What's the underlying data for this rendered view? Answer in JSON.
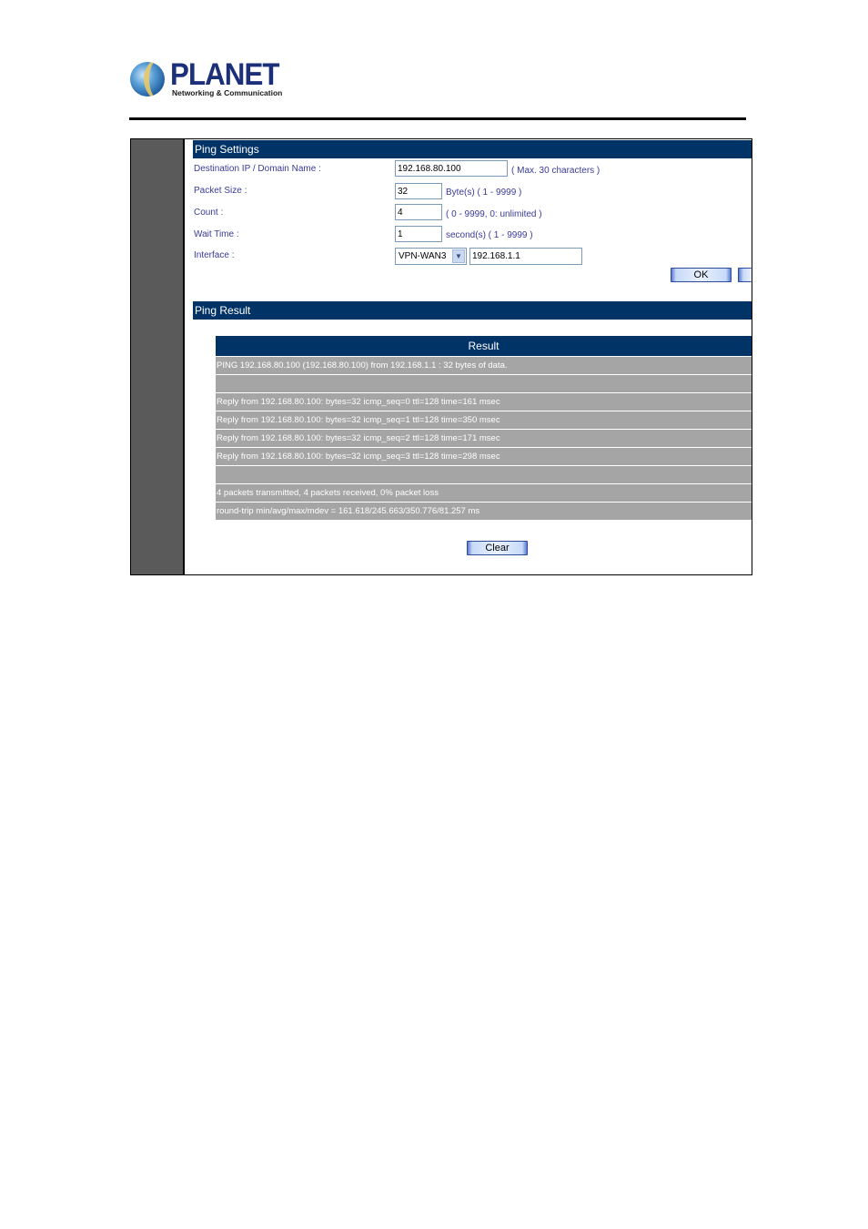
{
  "brand": {
    "name": "PLANET",
    "tagline": "Networking & Communication"
  },
  "ping_settings": {
    "title": "Ping Settings",
    "fields": {
      "destination": {
        "label": "Destination IP / Domain Name :",
        "value": "192.168.80.100",
        "hint": "( Max. 30 characters )"
      },
      "packet_size": {
        "label": "Packet Size :",
        "value": "32",
        "hint": "Byte(s) ( 1 - 9999 )"
      },
      "count": {
        "label": "Count :",
        "value": "4",
        "hint": "( 0 - 9999, 0: unlimited )"
      },
      "wait_time": {
        "label": "Wait Time :",
        "value": "1",
        "hint": "second(s) ( 1 - 9999 )"
      },
      "interface": {
        "label": "Interface :",
        "selected": "VPN-WAN3",
        "ip_value": "192.168.1.1"
      }
    },
    "ok_label": "OK",
    "cancel_label": ""
  },
  "ping_result": {
    "title": "Ping Result",
    "table_header": "Result",
    "rows": [
      "PING 192.168.80.100 (192.168.80.100) from 192.168.1.1 : 32 bytes of data.",
      "",
      "Reply from 192.168.80.100: bytes=32 icmp_seq=0 ttl=128 time=161 msec",
      "Reply from 192.168.80.100: bytes=32 icmp_seq=1 ttl=128 time=350 msec",
      "Reply from 192.168.80.100: bytes=32 icmp_seq=2 ttl=128 time=171 msec",
      "Reply from 192.168.80.100: bytes=32 icmp_seq=3 ttl=128 time=298 msec",
      "",
      "4 packets transmitted, 4 packets received, 0% packet loss",
      "round-trip min/avg/max/mdev = 161.618/245.663/350.776/81.257 ms"
    ],
    "clear_label": "Clear"
  },
  "icons": {
    "dropdown": "chevron-down-icon",
    "logo": "planet-globe-icon"
  }
}
